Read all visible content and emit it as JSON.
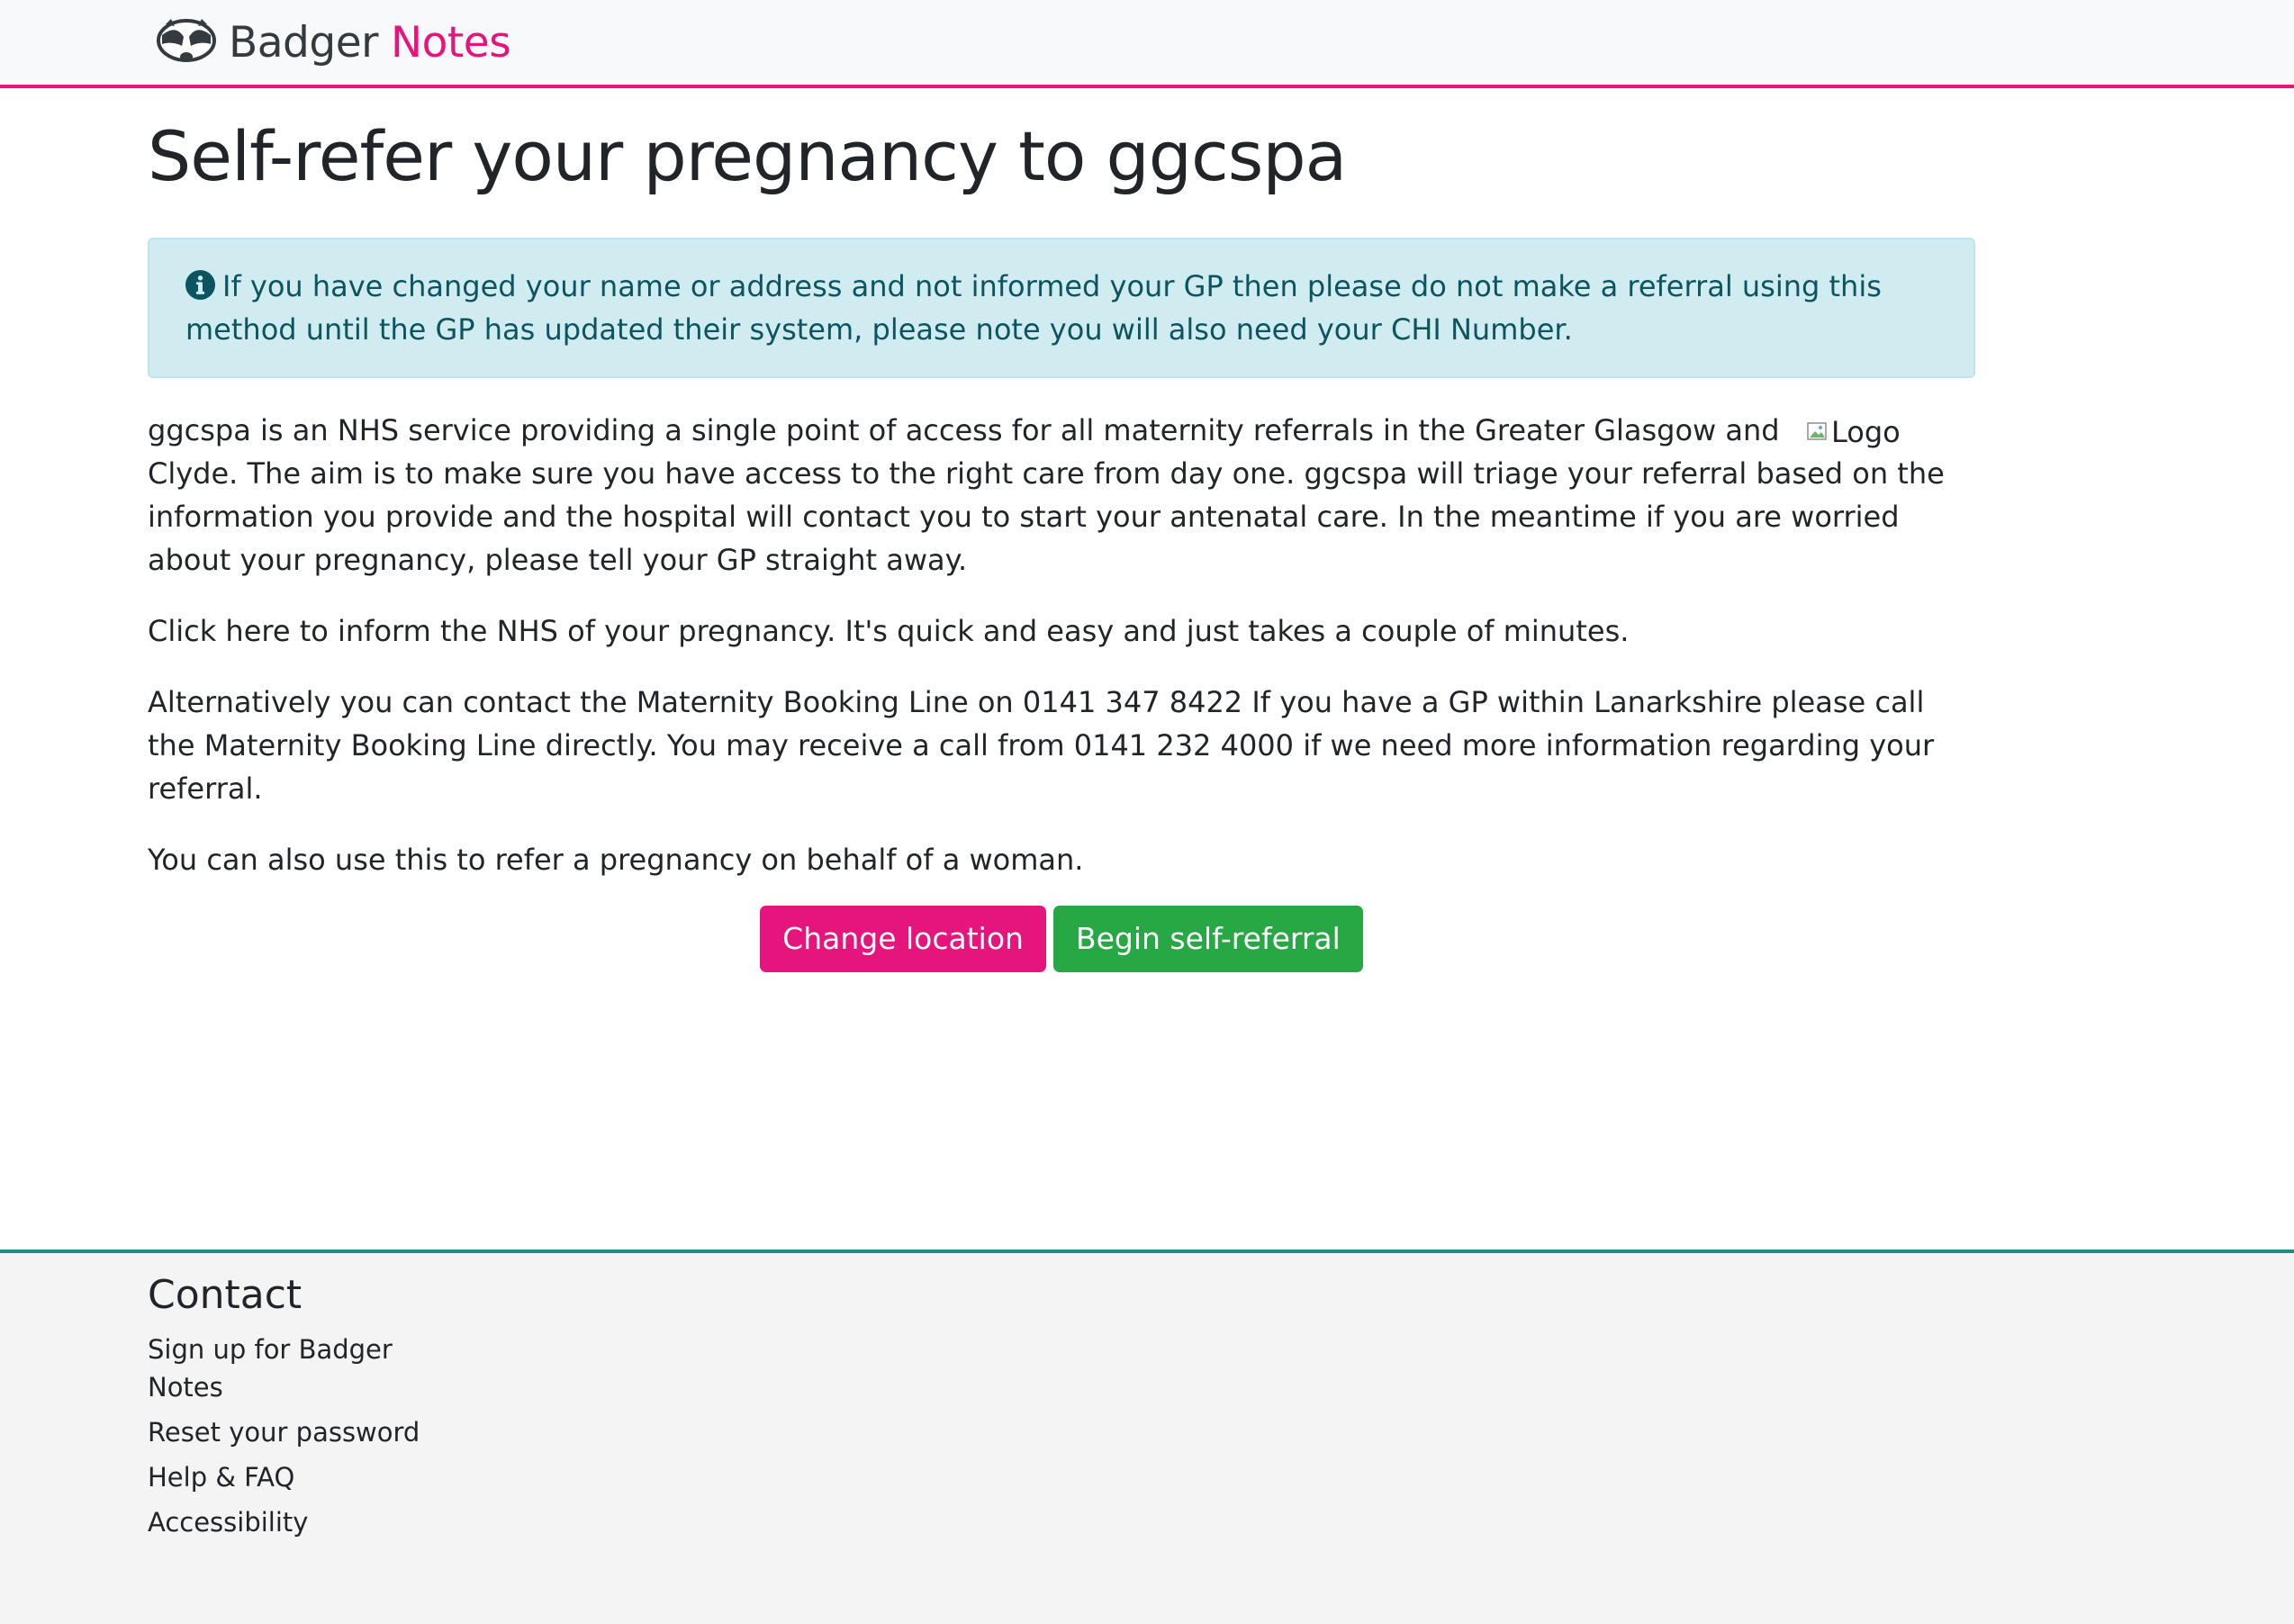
{
  "header": {
    "brand_name": "Badger",
    "brand_accent": "Notes",
    "logo_icon": "badger-icon"
  },
  "page": {
    "title": "Self-refer your pregnancy to ggcspa"
  },
  "alert": {
    "icon": "info-circle-icon",
    "text": "If you have changed your name or address and not informed your GP then please do not make a referral using this method until the GP has updated their system, please note you will also need your CHI Number."
  },
  "content": {
    "logo_alt": "Logo",
    "paragraphs": [
      "ggcspa is an NHS service providing a single point of access for all maternity referrals in the Greater Glasgow and Clyde. The aim is to make sure you have access to the right care from day one. ggcspa will triage your referral based on the information you provide and the hospital will contact you to start your antenatal care. In the meantime if you are worried about your pregnancy, please tell your GP straight away.",
      "Click here to inform the NHS of your pregnancy. It's quick and easy and just takes a couple of minutes.",
      "Alternatively you can contact the Maternity Booking Line on 0141 347 8422 If you have a GP within Lanarkshire please call the Maternity Booking Line directly. You may receive a call from 0141 232 4000 if we need more information regarding your referral.",
      "You can also use this to refer a pregnancy on behalf of a woman."
    ]
  },
  "actions": {
    "change_location": "Change location",
    "begin_referral": "Begin self-referral"
  },
  "footer": {
    "title": "Contact",
    "links": [
      "Sign up for Badger Notes",
      "Reset your password",
      "Help & FAQ",
      "Accessibility"
    ]
  },
  "colors": {
    "brand_pink": "#e6157e",
    "success_green": "#28a745",
    "info_bg": "#d1ecf1",
    "info_text": "#0c5460",
    "footer_border": "#1f8a86"
  }
}
